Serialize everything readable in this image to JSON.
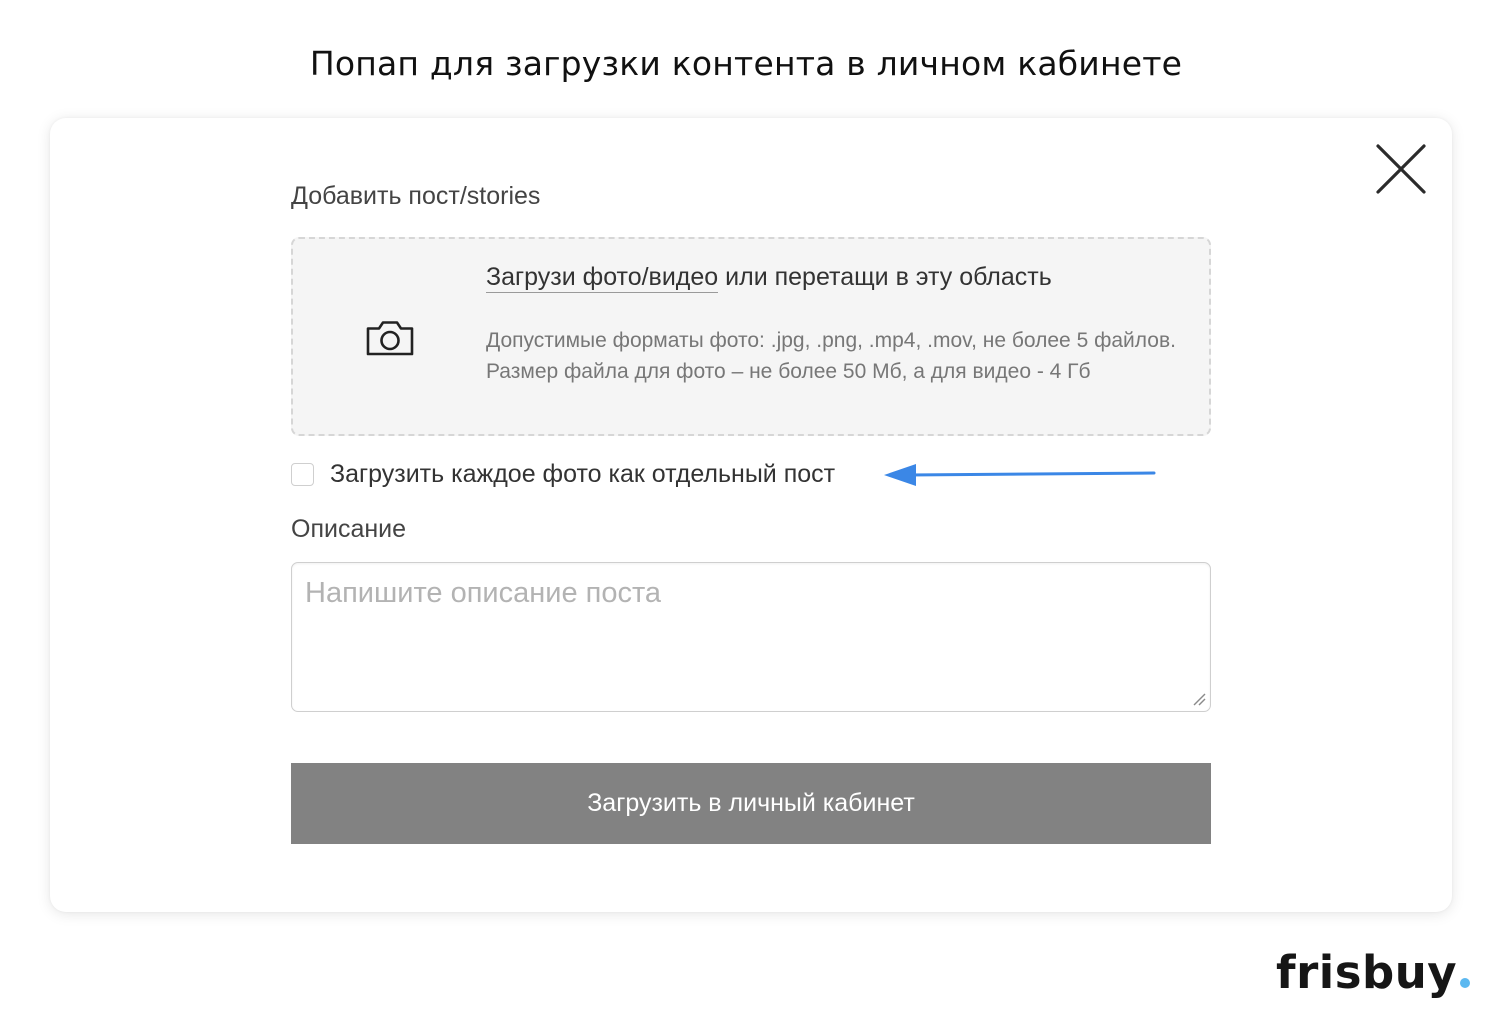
{
  "caption": "Попап для загрузки контента в личном кабинете",
  "popup": {
    "close_icon": "close-icon",
    "section_title": "Добавить пост/stories",
    "dropzone": {
      "icon": "camera-icon",
      "link_text": "Загрузи фото/видео",
      "title_rest": " или перетащи в эту область",
      "description": "Допустимые форматы фото: .jpg, .png, .mp4, .mov, не более 5 файлов. Размер файла для фото – не более 50 Мб, а для видео - 4 Гб"
    },
    "separate_post_checkbox": {
      "label": "Загрузить каждое фото как отдельный пост",
      "checked": false
    },
    "annotation_arrow_color": "#3b87e6",
    "description_section": {
      "label": "Описание",
      "placeholder": "Напишите описание поста",
      "value": ""
    },
    "submit_button": {
      "label": "Загрузить в личный кабинет",
      "background": "#828282"
    }
  },
  "brand": {
    "name": "frisbuy",
    "dot_color": "#5bb8f0"
  }
}
